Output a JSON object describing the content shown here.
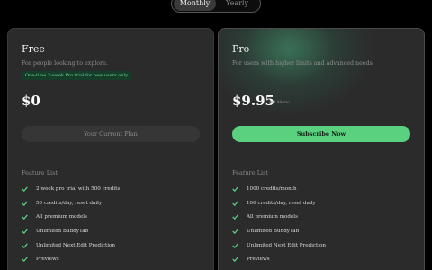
{
  "billing_toggle": {
    "options": [
      "Monthly",
      "Yearly"
    ],
    "selected": "Monthly"
  },
  "plans": {
    "free": {
      "name": "Free",
      "description": "For people looking to explore.",
      "badge": "One-time 2-week Pro trial for new users only",
      "price": "$0",
      "button_label": "Your Current Plan",
      "feature_title": "Feature List",
      "features": [
        "2 week pro trial with 500 credits",
        "50 credits/day, reset daily",
        "All premium models",
        "Unlimited BuddyTab",
        "Unlimited Next Edit Prediction",
        "Previews"
      ]
    },
    "pro": {
      "name": "Pro",
      "description": "For users with higher limits and advanced needs.",
      "price": "$9.95",
      "price_note": "/$9.99/mo",
      "button_label": "Subscribe Now",
      "feature_title": "Feature List",
      "features": [
        "1000 credits/month",
        "100 credits/day, reset daily",
        "All premium models",
        "Unlimited BuddyTab",
        "Unlimited Next Edit Prediction",
        "Previews"
      ]
    }
  },
  "colors": {
    "accent": "#5ad17f",
    "card_bg": "#2b2b2b",
    "page_bg": "#000000",
    "badge_bg": "#153d2a",
    "badge_text": "#6fdc98"
  }
}
